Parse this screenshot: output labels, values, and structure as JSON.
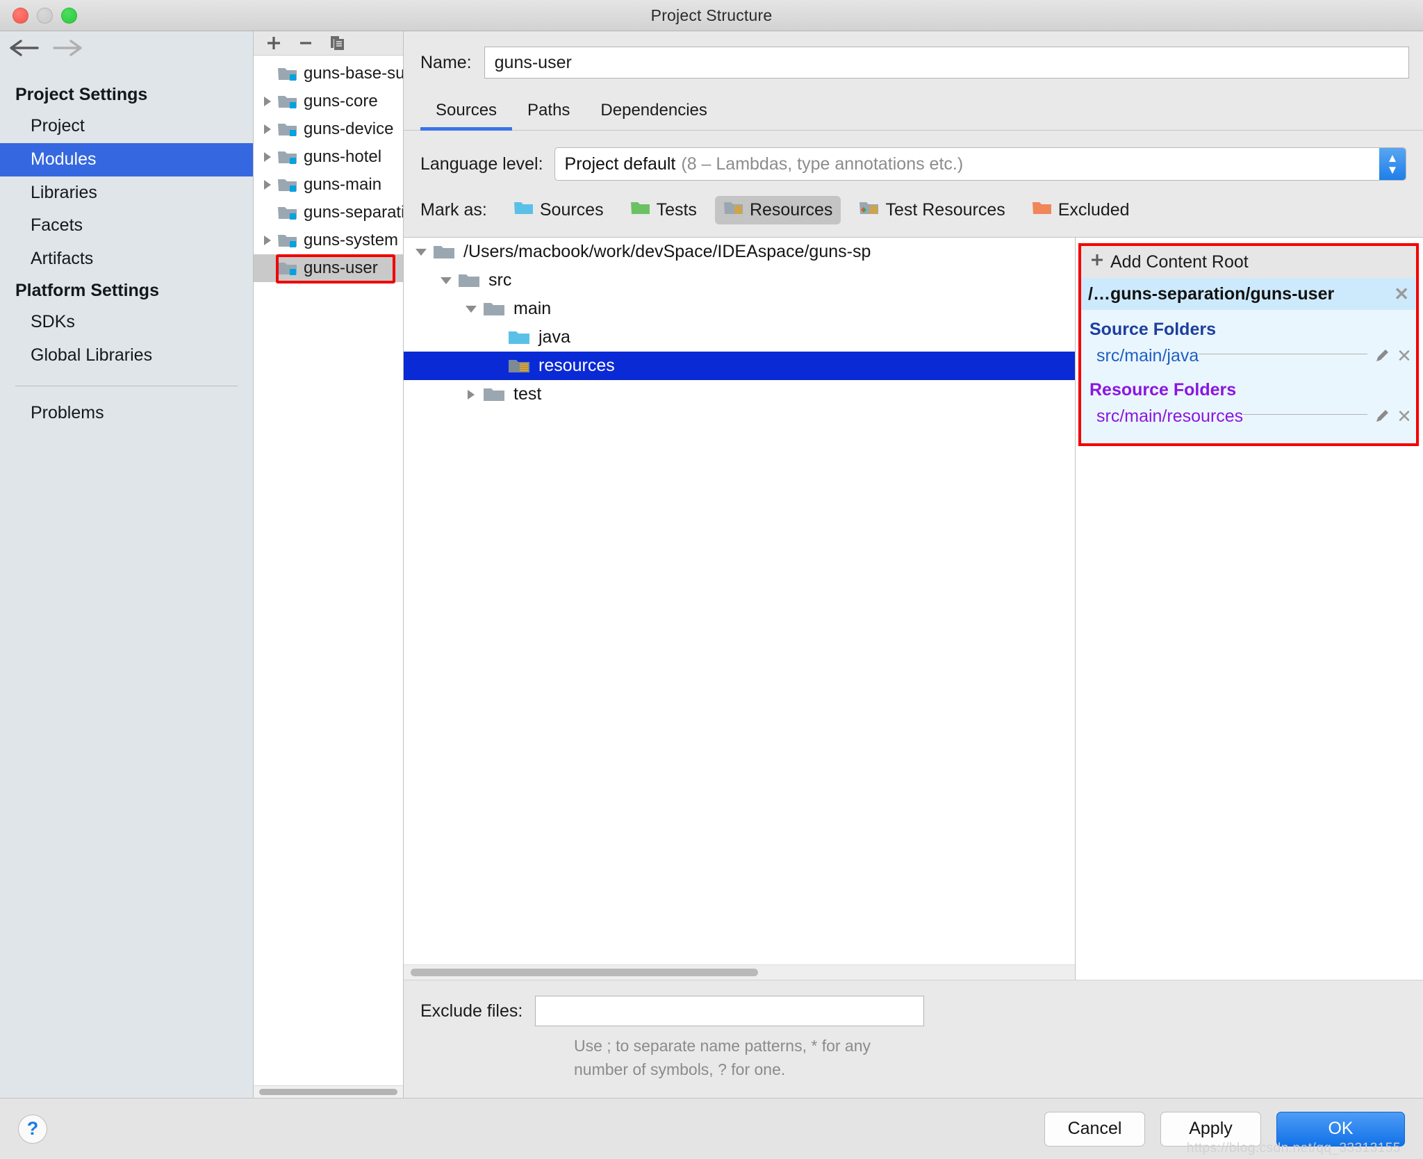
{
  "window": {
    "title": "Project Structure",
    "traffic_lights": [
      "close",
      "minimize",
      "zoom"
    ]
  },
  "sidebar": {
    "back_icon": "arrow-left-icon",
    "forward_icon": "arrow-right-icon",
    "groups": [
      {
        "label": "Project Settings",
        "items": [
          {
            "label": "Project",
            "selected": false
          },
          {
            "label": "Modules",
            "selected": true
          },
          {
            "label": "Libraries",
            "selected": false
          },
          {
            "label": "Facets",
            "selected": false
          },
          {
            "label": "Artifacts",
            "selected": false
          }
        ]
      },
      {
        "label": "Platform Settings",
        "items": [
          {
            "label": "SDKs",
            "selected": false
          },
          {
            "label": "Global Libraries",
            "selected": false
          }
        ]
      }
    ],
    "problems_label": "Problems"
  },
  "modules_panel": {
    "toolbar": {
      "add_icon": "plus-icon",
      "remove_icon": "minus-icon",
      "copy_icon": "copy-icon"
    },
    "modules": [
      {
        "label": "guns-base-support",
        "expandable": false,
        "selected": false
      },
      {
        "label": "guns-core",
        "expandable": true,
        "selected": false
      },
      {
        "label": "guns-device",
        "expandable": true,
        "selected": false
      },
      {
        "label": "guns-hotel",
        "expandable": true,
        "selected": false
      },
      {
        "label": "guns-main",
        "expandable": true,
        "selected": false
      },
      {
        "label": "guns-separation",
        "expandable": false,
        "selected": false
      },
      {
        "label": "guns-system",
        "expandable": true,
        "selected": false
      },
      {
        "label": "guns-user",
        "expandable": false,
        "selected": true
      }
    ]
  },
  "detail": {
    "name_label": "Name:",
    "name_value": "guns-user",
    "tabs": [
      {
        "label": "Sources",
        "active": true
      },
      {
        "label": "Paths",
        "active": false
      },
      {
        "label": "Dependencies",
        "active": false
      }
    ],
    "language_level": {
      "label": "Language level:",
      "value_main": "Project default",
      "value_detail": "(8 – Lambdas, type annotations etc.)",
      "stepper_icon": "stepper-up-down-icon"
    },
    "mark_as": {
      "label": "Mark as:",
      "options": [
        {
          "label": "Sources",
          "mnemonic": "S",
          "icon": "folder-sources-icon",
          "active": false
        },
        {
          "label": "Tests",
          "mnemonic": "T",
          "icon": "folder-tests-icon",
          "active": false
        },
        {
          "label": "Resources",
          "mnemonic": "",
          "icon": "folder-resources-icon",
          "active": true
        },
        {
          "label": "Test Resources",
          "mnemonic": "",
          "icon": "folder-test-resources-icon",
          "active": false
        },
        {
          "label": "Excluded",
          "mnemonic": "E",
          "icon": "folder-excluded-icon",
          "active": false
        }
      ]
    },
    "tree": [
      {
        "label": "/Users/macbook/work/devSpace/IDEAspace/guns-sp",
        "depth": 0,
        "twisty": "down",
        "icon": "folder-plain-icon",
        "selected": false
      },
      {
        "label": "src",
        "depth": 1,
        "twisty": "down",
        "icon": "folder-plain-icon",
        "selected": false
      },
      {
        "label": "main",
        "depth": 2,
        "twisty": "down",
        "icon": "folder-plain-icon",
        "selected": false
      },
      {
        "label": "java",
        "depth": 3,
        "twisty": "none",
        "icon": "folder-sources-icon",
        "selected": false
      },
      {
        "label": "resources",
        "depth": 3,
        "twisty": "none",
        "icon": "folder-resources-icon",
        "selected": true
      },
      {
        "label": "test",
        "depth": 2,
        "twisty": "right",
        "icon": "folder-plain-icon",
        "selected": false
      }
    ],
    "content_root": {
      "add_label": "Add Content Root",
      "add_icon": "plus-icon",
      "path": "/…guns-separation/guns-user",
      "source_folders_label": "Source Folders",
      "source_folders": [
        "src/main/java"
      ],
      "resource_folders_label": "Resource Folders",
      "resource_folders": [
        "src/main/resources"
      ],
      "edit_icon": "pencil-icon",
      "remove_icon": "close-x-icon",
      "highlight_color": "#f40000"
    },
    "exclude": {
      "label": "Exclude files:",
      "value": "",
      "placeholder": "",
      "hint": "Use ; to separate name patterns, * for any number of symbols, ? for one."
    }
  },
  "footer": {
    "help_label": "?",
    "cancel_label": "Cancel",
    "apply_label": "Apply",
    "ok_label": "OK",
    "watermark": "https://blog.csdn.net/qq_33313155"
  },
  "colors": {
    "accent_blue": "#3568e0",
    "tree_selection": "#0a2ad6",
    "highlight_red": "#f40000",
    "source_folder": "#1f5fc4",
    "resource_folder": "#8a16e0"
  }
}
